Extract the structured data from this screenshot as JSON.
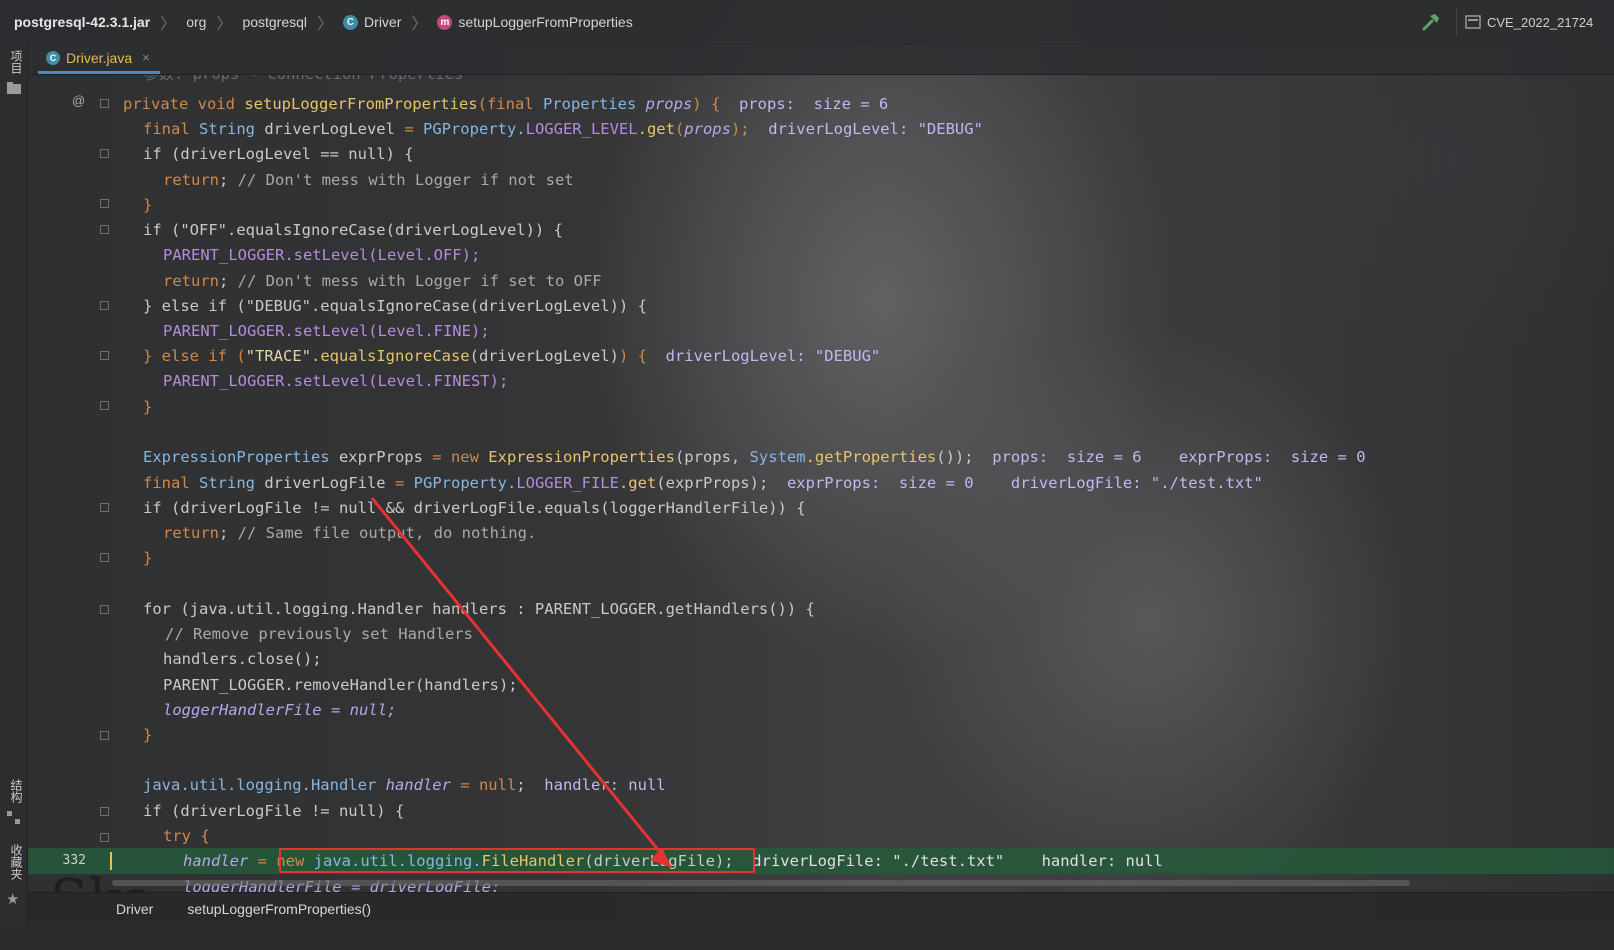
{
  "navbar": {
    "crumbs": [
      "postgresql-42.3.1.jar",
      "org",
      "postgresql",
      "Driver",
      "setupLoggerFromProperties"
    ],
    "run_config": "CVE_2022_21724"
  },
  "toolstrip": {
    "project": "项目",
    "structure": "结构",
    "favorites": "收藏夹"
  },
  "tab": {
    "label": "Driver.java",
    "close": "×"
  },
  "editor": {
    "current_line_number": "332",
    "top_partial_comment": "参数: props - Connection Properties",
    "lines": [
      "private void setupLoggerFromProperties(final Properties props) {",
      "final String driverLogLevel = PGProperty.LOGGER_LEVEL.get(props);",
      "if (driverLogLevel == null) {",
      "return; // Don't mess with Logger if not set",
      "}",
      "if (\"OFF\".equalsIgnoreCase(driverLogLevel)) {",
      "PARENT_LOGGER.setLevel(Level.OFF);",
      "return; // Don't mess with Logger if set to OFF",
      "} else if (\"DEBUG\".equalsIgnoreCase(driverLogLevel)) {",
      "PARENT_LOGGER.setLevel(Level.FINE);",
      "} else if (\"TRACE\".equalsIgnoreCase(driverLogLevel)) {",
      "PARENT_LOGGER.setLevel(Level.FINEST);",
      "}",
      "ExpressionProperties exprProps = new ExpressionProperties(props, System.getProperties());",
      "final String driverLogFile = PGProperty.LOGGER_FILE.get(exprProps);",
      "if (driverLogFile != null && driverLogFile.equals(loggerHandlerFile)) {",
      "return; // Same file output, do nothing.",
      "}",
      "for (java.util.logging.Handler handlers : PARENT_LOGGER.getHandlers()) {",
      "// Remove previously set Handlers",
      "handlers.close();",
      "PARENT_LOGGER.removeHandler(handlers);",
      "loggerHandlerFile = null;",
      "}",
      "java.util.logging.Handler handler = null;",
      "if (driverLogFile != null) {",
      "try {",
      "handler = new java.util.logging.FileHandler(driverLogFile);",
      "loggerHandlerFile = driverLogFile;"
    ],
    "hints": {
      "h1": "props:  size = 6",
      "h2": "driverLogLevel: \"DEBUG\"",
      "h3": "driverLogLevel: \"DEBUG\"",
      "h4": "props:  size = 6    exprProps:  size = 0",
      "h5": "exprProps:  size = 0    driverLogFile: \"./test.txt\"",
      "h6": "handler: null",
      "h7": "driverLogFile: \"./test.txt\"    handler: null"
    }
  },
  "bottombar": {
    "class": "Driver",
    "method": "setupLoggerFromProperties()"
  },
  "colors": {
    "current_line": "#255c3a",
    "annotation": "#e53232",
    "tab_text": "#e8b85a"
  }
}
